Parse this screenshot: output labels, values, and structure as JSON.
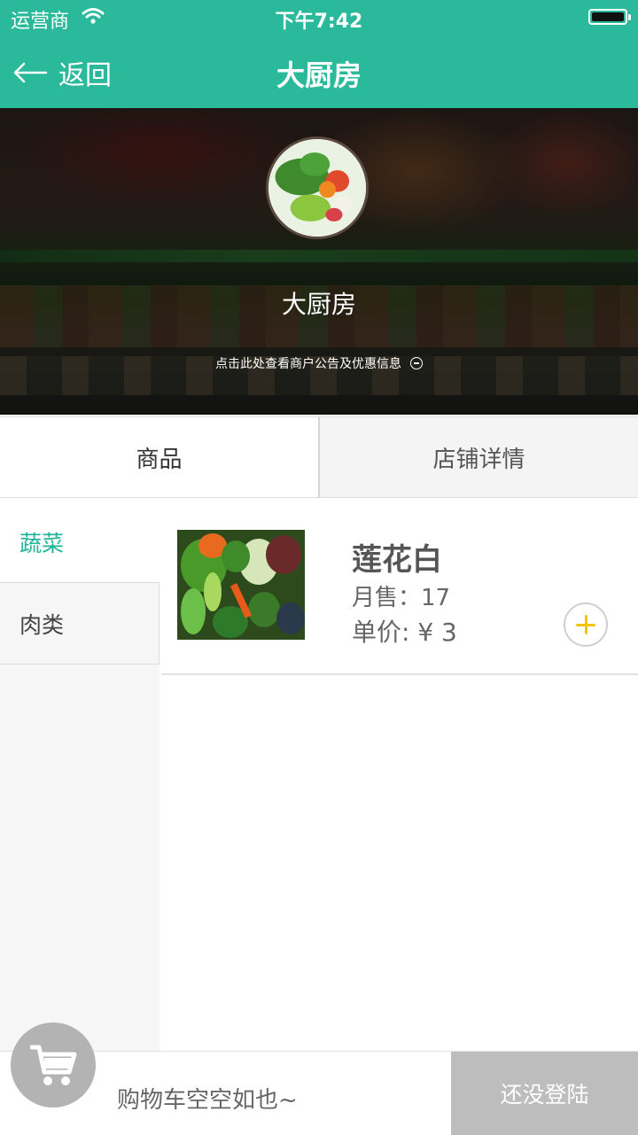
{
  "status_bar": {
    "carrier": "运营商",
    "time": "下午7:42"
  },
  "nav": {
    "back_label": "返回",
    "title": "大厨房"
  },
  "shop": {
    "name": "大厨房",
    "notice": "点击此处查看商户公告及优惠信息"
  },
  "tabs": [
    {
      "label": "商品"
    },
    {
      "label": "店铺详情"
    }
  ],
  "categories": [
    {
      "label": "蔬菜"
    },
    {
      "label": "肉类"
    }
  ],
  "products": [
    {
      "name": "莲花白",
      "sales": "月售：17",
      "price": "单价: ¥ 3"
    }
  ],
  "cart": {
    "empty_text": "购物车空空如也~",
    "login_label": "还没登陆"
  },
  "colors": {
    "primary": "#2bb99b",
    "active_category": "#1fb39a",
    "add_plus": "#f5c400",
    "disabled": "#bdbdbd"
  }
}
